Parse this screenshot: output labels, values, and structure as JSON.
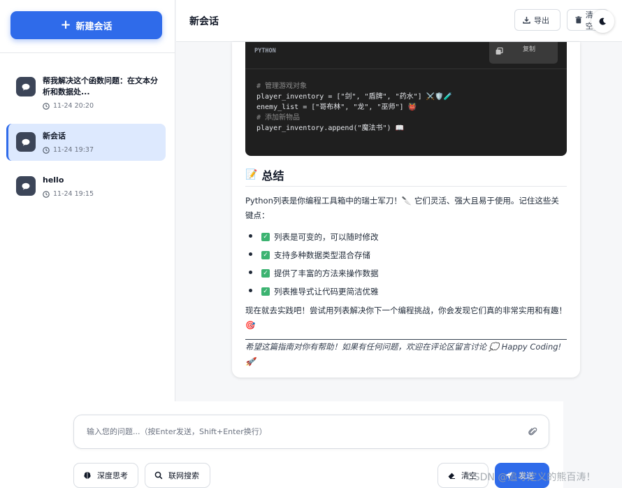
{
  "sidebar": {
    "new_chat_label": "新建会话",
    "conversations": [
      {
        "title": "帮我解决这个函数问题：在文本分析和数据处...",
        "time": "11-24 20:20"
      },
      {
        "title": "新会话",
        "time": "11-24 19:37"
      },
      {
        "title": "hello",
        "time": "11-24 19:15"
      }
    ]
  },
  "header": {
    "title": "新会话",
    "export_label": "导出",
    "clear_label": "清空"
  },
  "message": {
    "code": {
      "language": "PYTHON",
      "copy_label": "复制",
      "lines": [
        "# 管理游戏对象",
        "player_inventory = [\"剑\", \"盾牌\", \"药水\"] ⚔️🛡️🧪",
        "enemy_list = [\"哥布林\", \"龙\", \"巫师\"] 👹",
        "",
        "# 添加新物品",
        "player_inventory.append(\"魔法书\") 📖"
      ]
    },
    "summary_emoji": "📝",
    "summary_title": "总结",
    "intro": "Python列表是你编程工具箱中的瑞士军刀！🔪 它们灵活、强大且易于使用。记住这些关键点：",
    "bullets": [
      "列表是可变的，可以随时修改",
      "支持多种数据类型混合存储",
      "提供了丰富的方法来操作数据",
      "列表推导式让代码更简洁优雅"
    ],
    "outro": "现在就去实践吧！尝试用列表解决你下一个编程挑战，你会发现它们真的非常实用和有趣！🎯",
    "closing": "希望这篇指南对你有帮助！如果有任何问题，欢迎在评论区留言讨论 💭 Happy Coding! 🚀"
  },
  "input": {
    "placeholder": "输入您的问题...（按Enter发送，Shift+Enter换行）",
    "value": "",
    "deep_think_label": "深度思考",
    "web_search_label": "联网搜索",
    "clear_label": "清空",
    "send_label": "发送"
  },
  "watermark": "CSDN @追寻定义的熊百涛！",
  "colors": {
    "accent": "#2f6bea",
    "code_bg": "#1f1f1f",
    "active_item_bg": "#dde9fe",
    "check_green": "#3cb371"
  }
}
